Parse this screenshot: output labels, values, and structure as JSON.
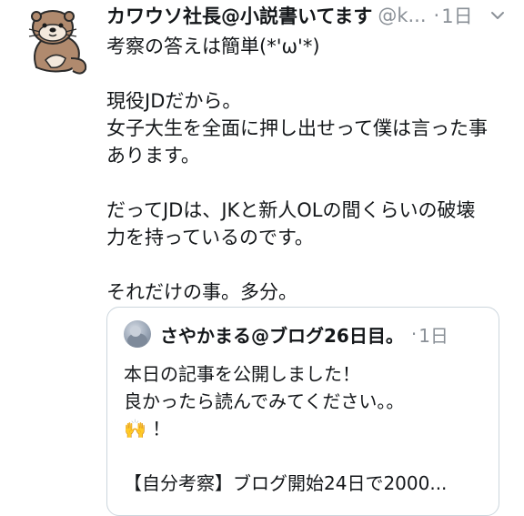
{
  "tweet": {
    "author_name": "カワウソ社長@小説書いてます",
    "author_handle": "@k...",
    "separator": "·",
    "time": "1日",
    "avatar_icon": "otter-avatar-icon",
    "menu_icon": "chevron-down-icon",
    "lines": [
      "考察の答えは簡単(*'ω'*)",
      "",
      "現役JDだから。",
      "女子大生を全面に押し出せって僕は言った事",
      "あります。",
      "",
      "だってJDは、JKと新人OLの間くらいの破壊",
      "力を持っているのです。",
      "",
      "それだけの事。多分。"
    ]
  },
  "quoted": {
    "author_name": "さやかまる@ブログ26日目。",
    "separator": "·",
    "time": "1日",
    "lines": [
      "本日の記事を公開しました！",
      "良かったら読んでみてください。。",
      "🙌 ！",
      "",
      "【自分考察】ブログ開始24日で2000..."
    ]
  }
}
